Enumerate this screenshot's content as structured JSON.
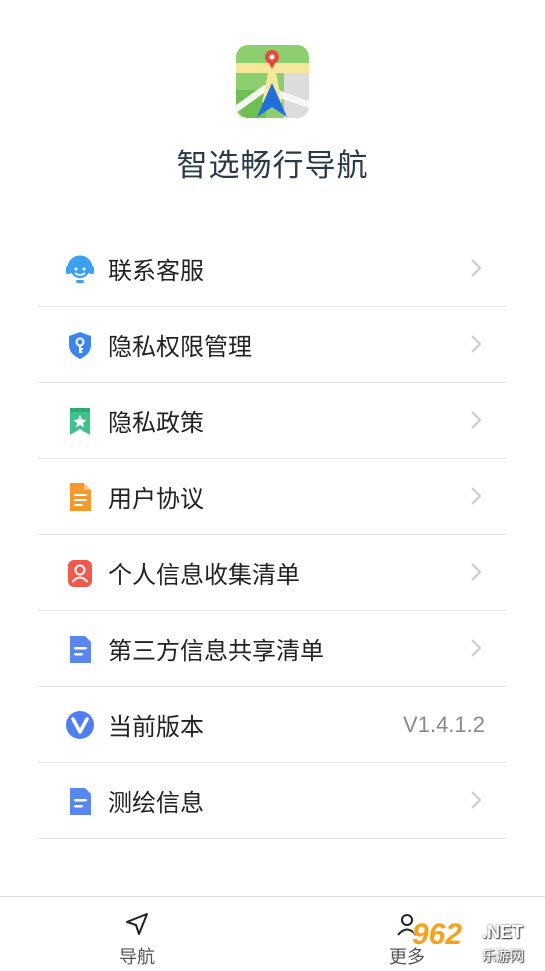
{
  "app": {
    "name": "智选畅行导航",
    "logo_icon": "map-navigation-logo"
  },
  "menu": [
    {
      "label": "联系客服",
      "icon": "customer-service-icon",
      "color": "#3aa0f0"
    },
    {
      "label": "隐私权限管理",
      "icon": "shield-key-icon",
      "color": "#3a86f0"
    },
    {
      "label": "隐私政策",
      "icon": "bookmark-star-icon",
      "color": "#3cc28a"
    },
    {
      "label": "用户协议",
      "icon": "document-icon",
      "color": "#f49a2a"
    },
    {
      "label": "个人信息收集清单",
      "icon": "person-card-icon",
      "color": "#f05a4a"
    },
    {
      "label": "第三方信息共享清单",
      "icon": "document-lines-icon",
      "color": "#5a86f0"
    },
    {
      "label": "当前版本",
      "icon": "version-v-icon",
      "color": "#4f7ef0",
      "value": "V1.4.1.2"
    },
    {
      "label": "测绘信息",
      "icon": "document-lines-icon",
      "color": "#5a86f0"
    }
  ],
  "tabbar": {
    "nav_label": "导航",
    "more_label": "更多"
  },
  "watermark": {
    "number": "962",
    "domain": ".NET",
    "sub": "乐游网"
  }
}
